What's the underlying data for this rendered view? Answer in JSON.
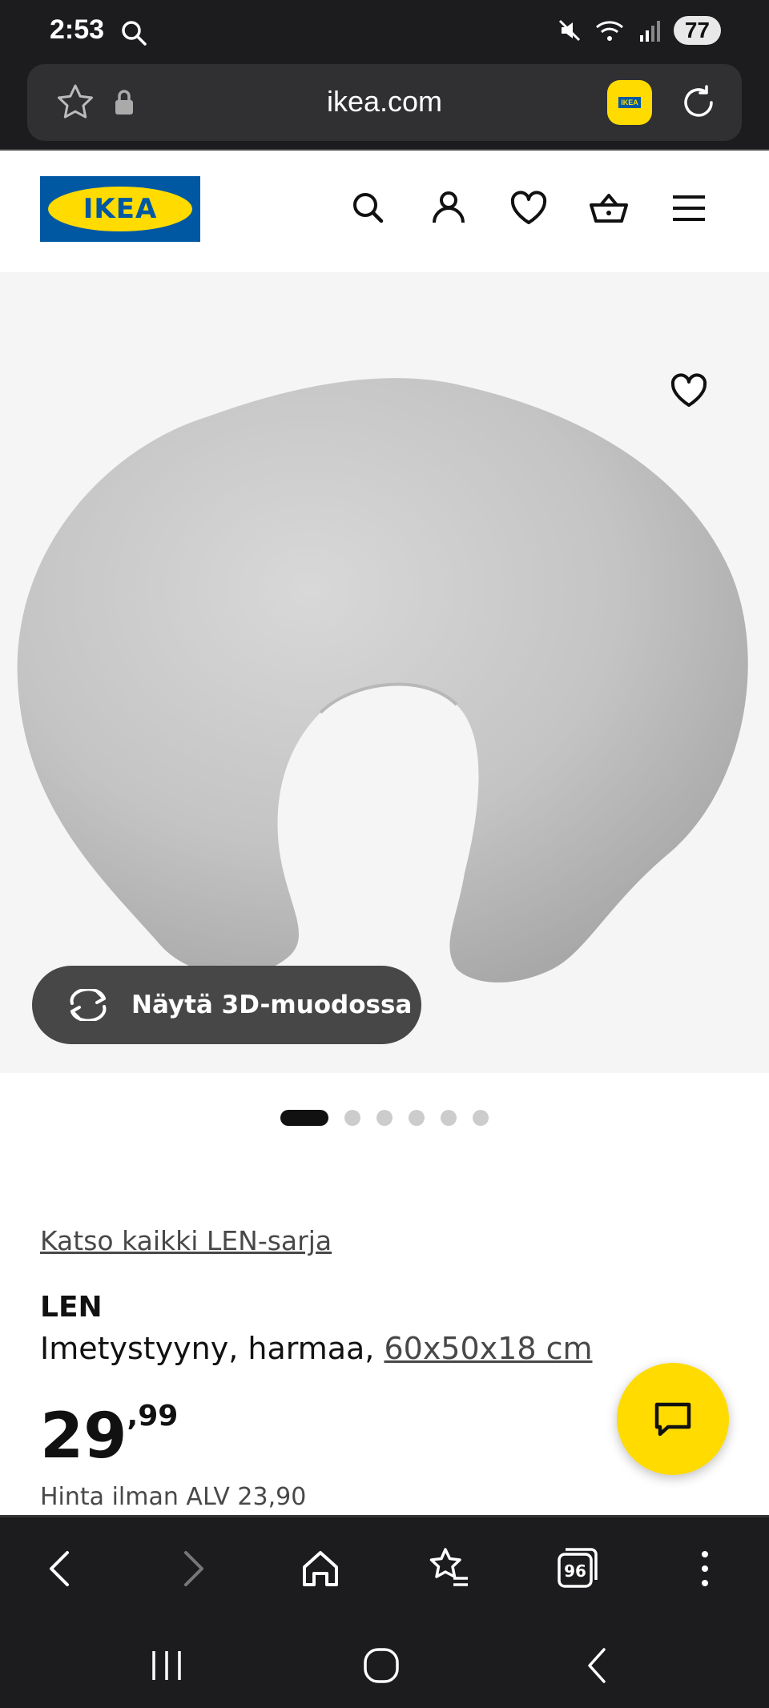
{
  "status_bar": {
    "time": "2:53",
    "battery": "77",
    "icons": [
      "search-icon",
      "mute-icon",
      "wifi-icon",
      "signal-icon"
    ]
  },
  "browser": {
    "url": "ikea.com",
    "ikea_badge": "IKEA"
  },
  "header": {
    "logo_text": "IKEA",
    "icons": [
      "search-icon",
      "user-icon",
      "heart-icon",
      "cart-icon",
      "menu-icon"
    ]
  },
  "gallery": {
    "view_3d_label": "Näytä 3D-muodossa",
    "image_count": 6,
    "active_index": 0
  },
  "product": {
    "series_link": "Katso kaikki LEN-sarja",
    "name": "LEN",
    "description": "Imetystyyny, harmaa, ",
    "size_link": "60x50x18 cm",
    "price_int": "29",
    "price_dec": ",99",
    "price_ex_vat": "Hinta ilman ALV 23,90"
  },
  "bottom_nav": {
    "tabs_count": "96"
  },
  "colors": {
    "ikea_blue": "#0058a3",
    "ikea_yellow": "#ffdb00",
    "dark_bar": "#1c1c1e"
  }
}
